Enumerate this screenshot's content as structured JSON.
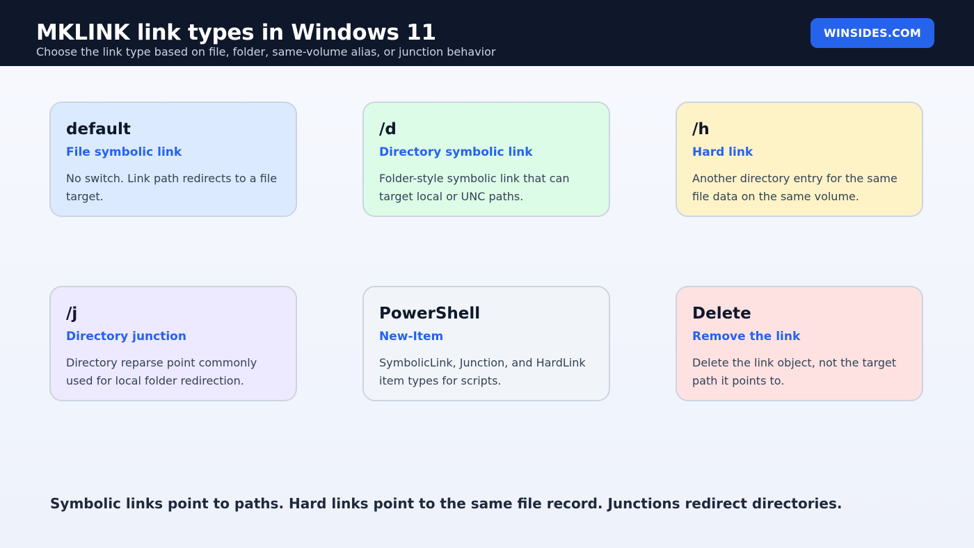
{
  "header": {
    "title": "MKLINK link types in Windows 11",
    "subtitle": "Choose the link type based on file, folder, same-volume alias, or junction behavior",
    "brand": "WINSIDES.COM",
    "colors": {
      "background": "#0f172a",
      "brand_button": "#2563eb"
    }
  },
  "cards": [
    {
      "title": "default",
      "subtitle": "File symbolic link",
      "description": "No switch. Link path redirects to a file target.",
      "color": "#dbeafe"
    },
    {
      "title": "/d",
      "subtitle": "Directory symbolic link",
      "description": "Folder-style symbolic link that can target local or UNC paths.",
      "color": "#dcfce7"
    },
    {
      "title": "/h",
      "subtitle": "Hard link",
      "description": "Another directory entry for the same file data on the same volume.",
      "color": "#fef3c7"
    },
    {
      "title": "/j",
      "subtitle": "Directory junction",
      "description": "Directory reparse point commonly used for local folder redirection.",
      "color": "#ede9fe"
    },
    {
      "title": "PowerShell",
      "subtitle": "New-Item",
      "description": "SymbolicLink, Junction, and HardLink item types for scripts.",
      "color": "#f1f5f9"
    },
    {
      "title": "Delete",
      "subtitle": "Remove the link",
      "description": "Delete the link object, not the target path it points to.",
      "color": "#fee2e2"
    }
  ],
  "footer": {
    "note": "Symbolic links point to paths. Hard links point to the same file record. Junctions redirect directories."
  }
}
